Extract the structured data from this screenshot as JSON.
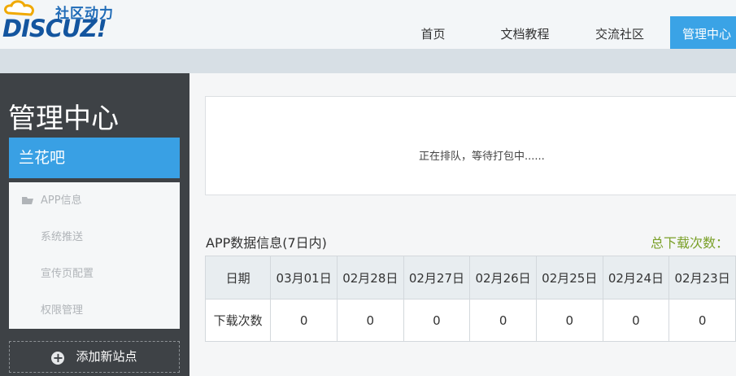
{
  "header": {
    "logo_cn": "社区动力",
    "logo_en": "DISCUZ!",
    "nav": [
      {
        "label": "首页"
      },
      {
        "label": "文档教程"
      },
      {
        "label": "交流社区"
      },
      {
        "label": "管理中心"
      }
    ]
  },
  "sidebar": {
    "title": "管理中心",
    "site_name": "兰花吧",
    "menu": [
      {
        "label": "APP信息",
        "icon": "folder-icon"
      },
      {
        "label": "系统推送"
      },
      {
        "label": "宣传页配置"
      },
      {
        "label": "权限管理"
      }
    ],
    "add_site_label": "添加新站点",
    "add_icon": "plus-circle-icon"
  },
  "main": {
    "status_text": "正在排队，等待打包中......",
    "data_title": "APP数据信息(7日内)",
    "total_label": "总下载次数：",
    "table": {
      "row_header_date": "日期",
      "row_header_downloads": "下载次数",
      "dates": [
        "03月01日",
        "02月28日",
        "02月27日",
        "02月26日",
        "02月25日",
        "02月24日",
        "02月23日"
      ],
      "downloads": [
        "0",
        "0",
        "0",
        "0",
        "0",
        "0",
        "0"
      ]
    }
  },
  "colors": {
    "accent": "#3aa3e6",
    "sidebar_bg": "#3e4246",
    "total_green": "#7aa028"
  }
}
